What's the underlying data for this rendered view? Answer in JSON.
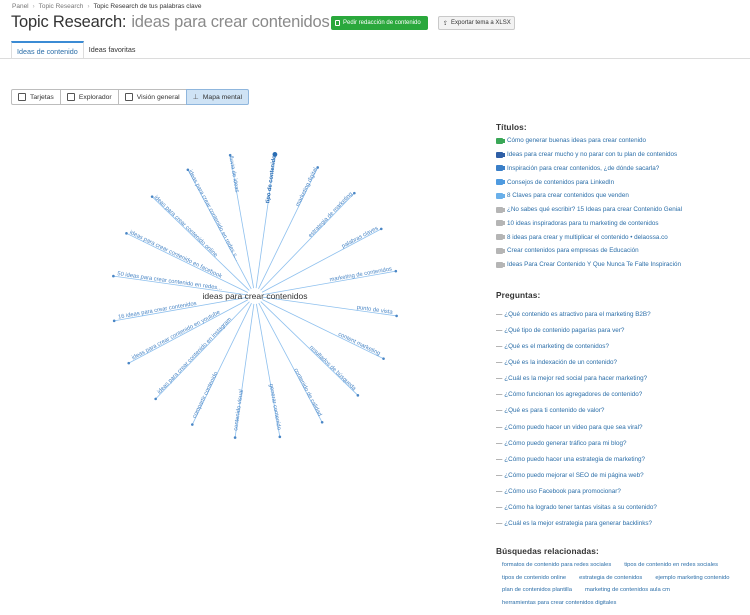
{
  "breadcrumb": [
    "Panel",
    "Topic Research",
    "Topic Research de tus palabras clave"
  ],
  "header": {
    "title": "Topic Research:",
    "topic": "ideas para crear contenidos",
    "order_button": "Pedir redacción de contenido",
    "export_button": "Exportar tema a XLSX"
  },
  "tabs": [
    "Ideas de contenido",
    "Ideas favoritas"
  ],
  "views": [
    "Tarjetas",
    "Explorador",
    "Visión general",
    "Mapa mental"
  ],
  "active_view": "Mapa mental",
  "mindmap": {
    "center": "ideas para crear contenidos",
    "branches": [
      {
        "label": "ideas para crear contenido en redes s...",
        "bold": false
      },
      {
        "label": "lluvia de ideas",
        "bold": false
      },
      {
        "label": "tipo de contenido",
        "bold": true
      },
      {
        "label": "marketing digital",
        "bold": false
      },
      {
        "label": "estrategia de marketing",
        "bold": false
      },
      {
        "label": "palabras claves",
        "bold": false
      },
      {
        "label": "marketing de contenidos",
        "bold": false
      },
      {
        "label": "punto de vista",
        "bold": false
      },
      {
        "label": "content marketing",
        "bold": false
      },
      {
        "label": "resultados de búsqueda",
        "bold": false
      },
      {
        "label": "contenido de calidad",
        "bold": false
      },
      {
        "label": "generar contenido",
        "bold": false
      },
      {
        "label": "contenido visual",
        "bold": false
      },
      {
        "label": "compartir contenido",
        "bold": false
      },
      {
        "label": "ideas para crear contenido en instagram",
        "bold": false
      },
      {
        "label": "ideas para crear contenido en youtube",
        "bold": false
      },
      {
        "label": "16 ideas para crear contenidos",
        "bold": false
      },
      {
        "label": "50 ideas para crear contenido en redes...",
        "bold": false
      },
      {
        "label": "ideas para crear contenido en facebook",
        "bold": false
      },
      {
        "label": "ideas para crear contenido online",
        "bold": false
      }
    ]
  },
  "titulos": {
    "heading": "Títulos:",
    "items": [
      {
        "text": "Cómo generar buenas ideas para crear contenido",
        "color": "#3aa757"
      },
      {
        "text": "Ideas para crear mucho y no parar con tu plan de contenidos",
        "color": "#2f5fa6"
      },
      {
        "text": "Inspiración para crear contenidos, ¿de dónde sacarla?",
        "color": "#3a7fc8"
      },
      {
        "text": "Consejos de contenidos para LinkedIn",
        "color": "#4f9be0"
      },
      {
        "text": "8 Claves para crear contenidos que venden",
        "color": "#6ab0ea"
      },
      {
        "text": "¿No sabes qué escribir? 15 Ideas para crear Contenido Genial",
        "color": "#b5b5b5"
      },
      {
        "text": "10 ideas inspiradoras para tu marketing de contenidos",
        "color": "#b5b5b5"
      },
      {
        "text": "8 ideas para crear y multiplicar el contenido • delaossa.co",
        "color": "#b5b5b5"
      },
      {
        "text": "Crear contenidos para empresas de Educación",
        "color": "#b5b5b5"
      },
      {
        "text": "Ideas Para Crear Contenido Y Que Nunca Te Falte Inspiración",
        "color": "#b5b5b5"
      }
    ]
  },
  "preguntas": {
    "heading": "Preguntas:",
    "items": [
      "¿Qué contenido es atractivo para el marketing B2B?",
      "¿Qué tipo de contenido pagarías para ver?",
      "¿Qué es el marketing de contenidos?",
      "¿Qué es la indexación de un contenido?",
      "¿Cuál es la mejor red social para hacer marketing?",
      "¿Cómo funcionan los agregadores de contenido?",
      "¿Qué es para ti contenido de valor?",
      "¿Cómo puedo hacer un video para que sea viral?",
      "¿Cómo puedo generar tráfico para mi blog?",
      "¿Cómo puedo hacer una estrategia de marketing?",
      "¿Cómo puedo mejorar el SEO de mi página web?",
      "¿Cómo uso Facebook para promocionar?",
      "¿Cómo ha logrado tener tantas visitas a su contenido?",
      "¿Cuál es la mejor estrategia para generar backlinks?"
    ]
  },
  "busquedas": {
    "heading": "Búsquedas relacionadas:",
    "items": [
      "formatos de contenido para redes sociales",
      "tipos de contenido en redes sociales",
      "tipos de contenido online",
      "estrategia de contenidos",
      "ejemplo marketing contenido",
      "plan de contenidos plantilla",
      "marketing de contenidos aula cm",
      "herramientas para crear contenidos digitales"
    ]
  },
  "colors": {
    "accent": "#2b6ea8",
    "green": "#2aa83c",
    "mindmap_line": "#8ec0ee"
  }
}
